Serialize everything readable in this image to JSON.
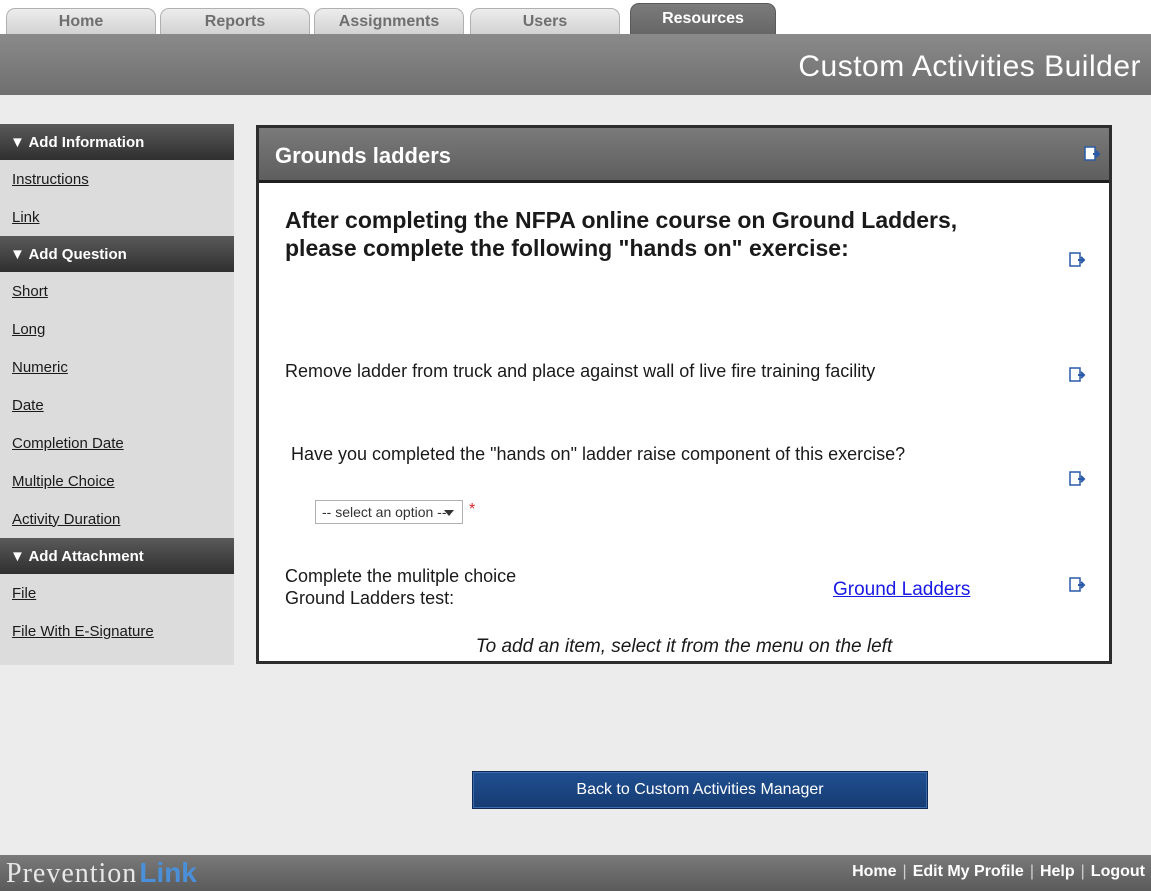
{
  "tabs": [
    {
      "label": "Home"
    },
    {
      "label": "Reports"
    },
    {
      "label": "Assignments"
    },
    {
      "label": "Users"
    },
    {
      "label": "Resources"
    }
  ],
  "header": {
    "title": "Custom Activities Builder"
  },
  "sidebar": {
    "sections": [
      {
        "title": "▼ Add Information",
        "items": [
          "Instructions",
          "Link"
        ]
      },
      {
        "title": "▼ Add Question",
        "items": [
          "Short",
          "Long",
          "Numeric",
          "Date",
          "Completion Date",
          "Multiple Choice",
          "Activity Duration"
        ]
      },
      {
        "title": "▼ Add Attachment",
        "items": [
          "File",
          "File With E-Signature"
        ]
      }
    ]
  },
  "panel": {
    "title": "Grounds ladders",
    "heading": "After completing the NFPA online course on Ground Ladders, please complete the following \"hands on\" exercise:",
    "instruction": "Remove ladder from truck and place against wall of live fire training facility",
    "question": "Have you completed the \"hands on\" ladder raise component of this exercise?",
    "select_value": "-- select an option --",
    "required_mark": "*",
    "link_label": "Complete the mulitple choice Ground Ladders test:",
    "link_text": "Ground Ladders",
    "hint": "To add an item, select it from the menu on the left"
  },
  "back_button": "Back to Custom Activities Manager",
  "footer": {
    "logo_part1": "Prevention",
    "logo_part2": "Link",
    "links": [
      "Home",
      "Edit My Profile",
      "Help",
      "Logout"
    ]
  },
  "colors": {
    "accent_blue": "#1f4f92",
    "link_blue": "#1a1ae6",
    "required_red": "#d9252a"
  }
}
